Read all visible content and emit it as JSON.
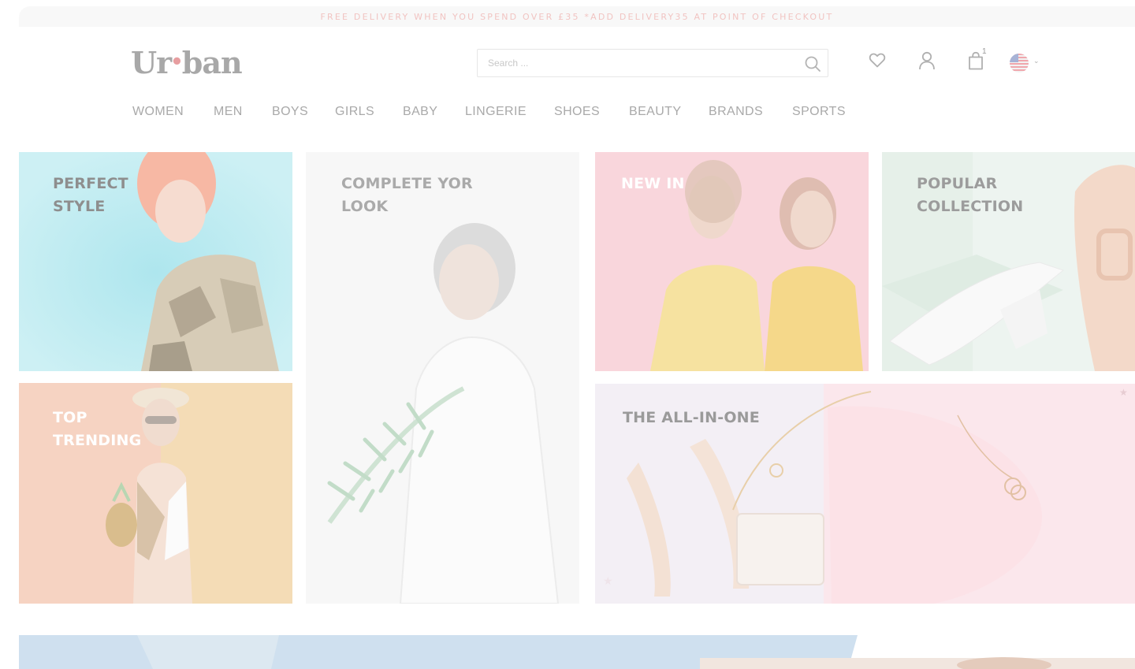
{
  "promo": {
    "text": "FREE DELIVERY WHEN YOU SPEND OVER £35 *ADD DELIVERY35 AT POINT OF CHECKOUT"
  },
  "header": {
    "logo_left": "Ur",
    "logo_dot": "•",
    "logo_right": "ban",
    "search": {
      "placeholder": "Search ...",
      "value": ""
    },
    "cart_count": "1",
    "icons": [
      "search-icon",
      "heart-icon",
      "user-icon",
      "shopping-bag-icon",
      "us-flag-icon",
      "chevron-down-icon"
    ]
  },
  "nav": {
    "items": [
      {
        "label": "WOMEN"
      },
      {
        "label": "MEN"
      },
      {
        "label": "BOYS"
      },
      {
        "label": "GIRLS"
      },
      {
        "label": "BABY"
      },
      {
        "label": "LINGERIE"
      },
      {
        "label": "SHOES"
      },
      {
        "label": "BEAUTY"
      },
      {
        "label": "BRANDS"
      },
      {
        "label": "SPORTS"
      }
    ]
  },
  "tiles": [
    {
      "label": "PERFECT\nSTYLE",
      "color": "#8e8e8e",
      "bg": "#c9eef3"
    },
    {
      "label": "COMPLETE YOR\nLOOK",
      "color": "#aaaaaa",
      "bg": "#f7f7f7"
    },
    {
      "label": "NEW IN",
      "color": "#ffffff",
      "bg": "#f9d6dc"
    },
    {
      "label": "POPULAR\nCOLLECTION",
      "color": "#9c9c9c",
      "bg": "#e8f1ec"
    },
    {
      "label": "TOP\nTRENDING",
      "color": "#ffffff",
      "bg": "#f6d3c2"
    },
    {
      "label": "THE ALL-IN-ONE",
      "color": "#9a9a9a",
      "bg": "#f3eff4"
    }
  ],
  "colors": {
    "accent": "#e79ea0",
    "promo_text": "#f1c4c2",
    "nav_text": "#a9a9a9"
  }
}
